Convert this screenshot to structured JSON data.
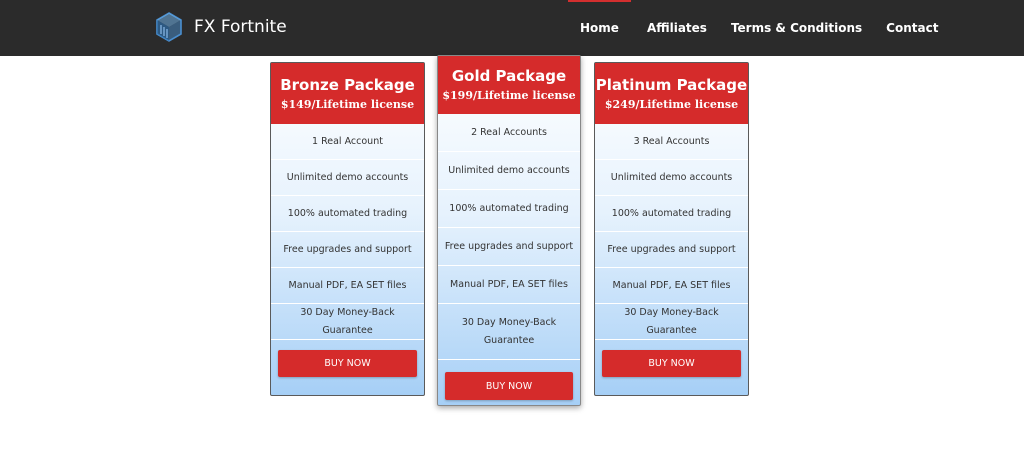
{
  "brand": {
    "name": "FX Fortnite",
    "logo_icon": "cube-logo-icon"
  },
  "nav": {
    "items": [
      {
        "label": "Home",
        "active": true
      },
      {
        "label": "Affiliates",
        "active": false
      },
      {
        "label": "Terms & Conditions",
        "active": false
      },
      {
        "label": "Contact",
        "active": false
      }
    ],
    "active_color": "#d32f2f"
  },
  "colors": {
    "navbar_bg": "#2b2b2b",
    "accent_red": "#d52b2b",
    "card_gradient_bottom": "#a6cff6"
  },
  "packages": [
    {
      "title": "Bronze Package",
      "price": "$149/Lifetime license",
      "features": [
        "1 Real Account",
        "Unlimited demo accounts",
        "100% automated trading",
        "Free upgrades and support",
        "Manual PDF, EA SET files",
        "30 Day Money-Back Guarantee"
      ],
      "button": "BUY NOW"
    },
    {
      "title": "Gold Package",
      "price": "$199/Lifetime license",
      "features": [
        "2 Real Accounts",
        "Unlimited demo accounts",
        "100% automated trading",
        "Free upgrades and support",
        "Manual PDF, EA SET files",
        "30 Day Money-Back Guarantee"
      ],
      "button": "BUY NOW"
    },
    {
      "title": "Platinum Package",
      "price": "$249/Lifetime license",
      "features": [
        "3 Real Accounts",
        "Unlimited demo accounts",
        "100% automated trading",
        "Free upgrades and support",
        "Manual PDF, EA SET files",
        "30 Day Money-Back Guarantee"
      ],
      "button": "BUY NOW"
    }
  ]
}
